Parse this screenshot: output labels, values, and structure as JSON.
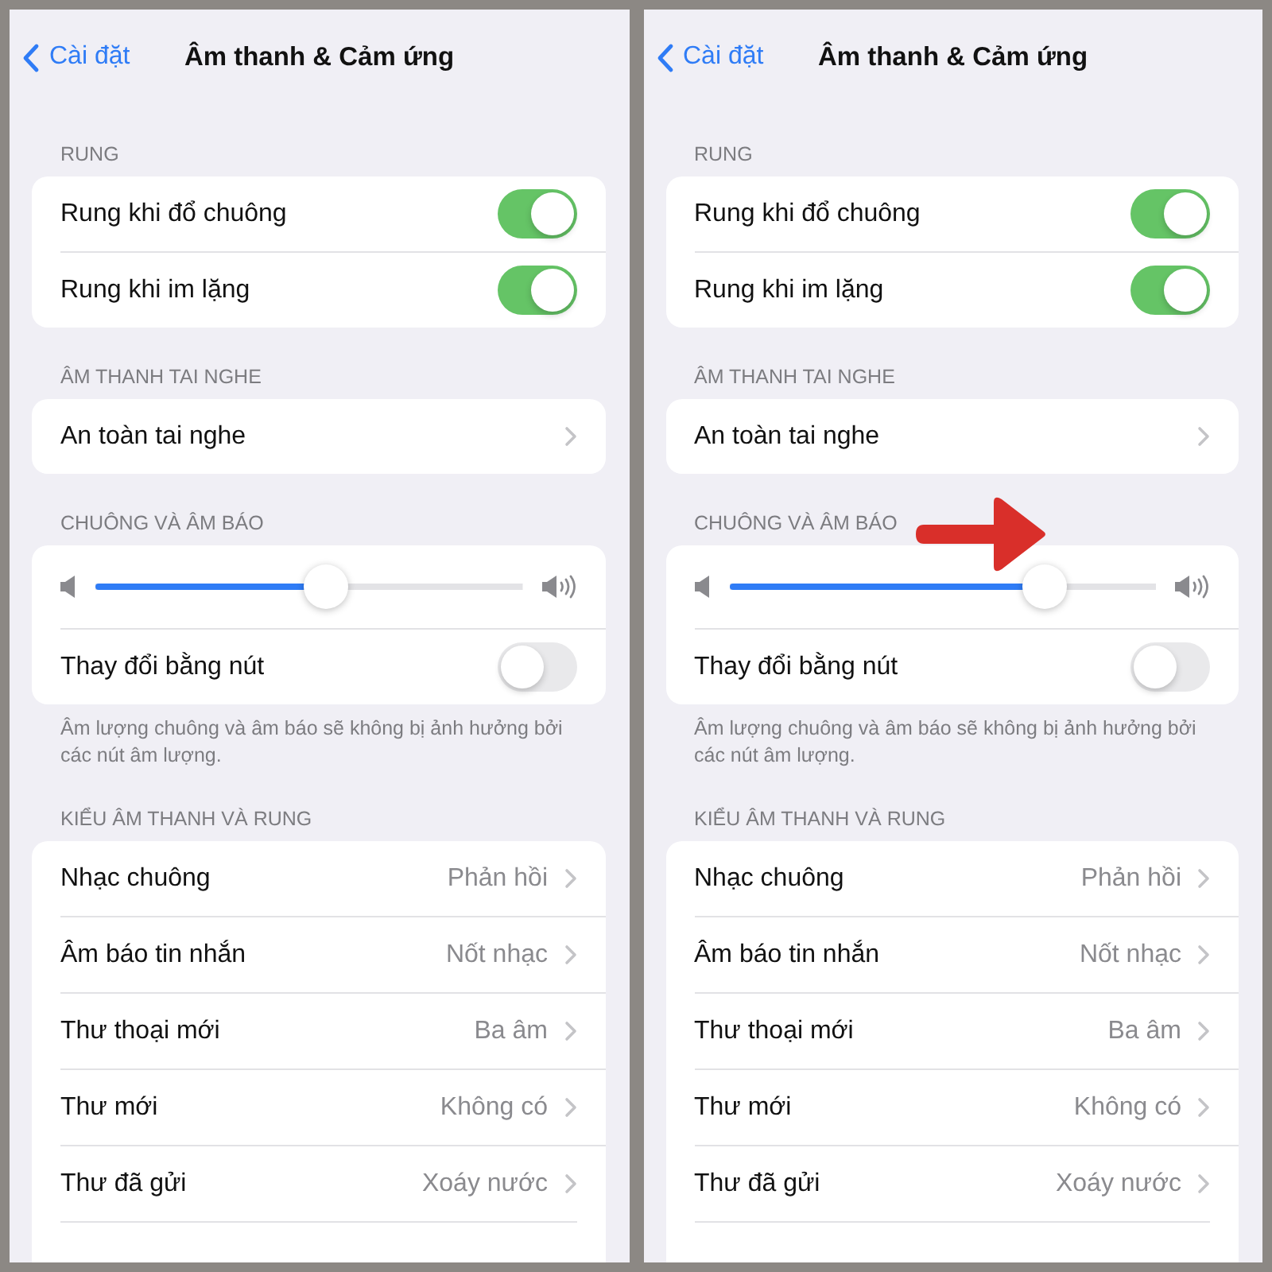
{
  "screens": [
    {
      "nav": {
        "back": "Cài đặt",
        "title": "Âm thanh & Cảm ứng"
      },
      "arrow": false,
      "sections": [
        {
          "header": "RUNG",
          "rows": [
            {
              "kind": "toggle",
              "label": "Rung khi đổ chuông",
              "on": true
            },
            {
              "kind": "toggle",
              "label": "Rung khi im lặng",
              "on": true
            }
          ]
        },
        {
          "header": "ÂM THANH TAI NGHE",
          "rows": [
            {
              "kind": "link",
              "label": "An toàn tai nghe"
            }
          ]
        },
        {
          "header": "CHUÔNG VÀ ÂM BÁO",
          "rows": [
            {
              "kind": "slider",
              "level": 0.54
            },
            {
              "kind": "toggle",
              "label": "Thay đổi bằng nút",
              "on": false
            }
          ],
          "footer": "Âm lượng chuông và âm báo sẽ không bị ảnh hưởng bởi các nút âm lượng."
        },
        {
          "header": "KIỂU ÂM THANH VÀ RUNG",
          "rows": [
            {
              "kind": "link",
              "label": "Nhạc chuông",
              "value": "Phản hồi"
            },
            {
              "kind": "link",
              "label": "Âm báo tin nhắn",
              "value": "Nốt nhạc"
            },
            {
              "kind": "link",
              "label": "Thư thoại mới",
              "value": "Ba âm"
            },
            {
              "kind": "link",
              "label": "Thư mới",
              "value": "Không có"
            },
            {
              "kind": "link",
              "label": "Thư đã gửi",
              "value": "Xoáy nước"
            }
          ]
        }
      ]
    },
    {
      "nav": {
        "back": "Cài đặt",
        "title": "Âm thanh & Cảm ứng"
      },
      "arrow": true,
      "sections": [
        {
          "header": "RUNG",
          "rows": [
            {
              "kind": "toggle",
              "label": "Rung khi đổ chuông",
              "on": true
            },
            {
              "kind": "toggle",
              "label": "Rung khi im lặng",
              "on": true
            }
          ]
        },
        {
          "header": "ÂM THANH TAI NGHE",
          "rows": [
            {
              "kind": "link",
              "label": "An toàn tai nghe"
            }
          ]
        },
        {
          "header": "CHUÔNG VÀ ÂM BÁO",
          "rows": [
            {
              "kind": "slider",
              "level": 0.74
            },
            {
              "kind": "toggle",
              "label": "Thay đổi bằng nút",
              "on": false
            }
          ],
          "footer": "Âm lượng chuông và âm báo sẽ không bị ảnh hưởng bởi các nút âm lượng."
        },
        {
          "header": "KIỂU ÂM THANH VÀ RUNG",
          "rows": [
            {
              "kind": "link",
              "label": "Nhạc chuông",
              "value": "Phản hồi"
            },
            {
              "kind": "link",
              "label": "Âm báo tin nhắn",
              "value": "Nốt nhạc"
            },
            {
              "kind": "link",
              "label": "Thư thoại mới",
              "value": "Ba âm"
            },
            {
              "kind": "link",
              "label": "Thư mới",
              "value": "Không có"
            },
            {
              "kind": "link",
              "label": "Thư đã gửi",
              "value": "Xoáy nước"
            }
          ]
        }
      ]
    }
  ]
}
